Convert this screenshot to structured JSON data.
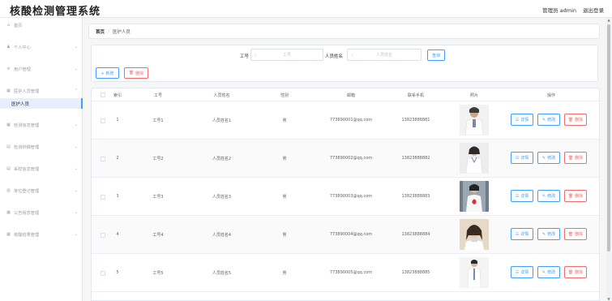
{
  "app": {
    "title": "核酸检测管理系统",
    "user_label": "管理员 admin",
    "logout_label": "退出登录"
  },
  "sidebar": {
    "items": [
      {
        "label": "首页",
        "icon": "home-icon",
        "glyph": "⌂",
        "has_chevron": false
      },
      {
        "label": "个人中心",
        "icon": "user-icon",
        "glyph": "♟",
        "has_chevron": true
      },
      {
        "label": "用户管理",
        "icon": "users-icon",
        "glyph": "≡",
        "has_chevron": true
      },
      {
        "label": "医护人员管理",
        "icon": "grid-icon",
        "glyph": "▦",
        "has_chevron": true
      },
      {
        "label": "检测信息管理",
        "icon": "grid-icon",
        "glyph": "▦",
        "has_chevron": true
      },
      {
        "label": "检测供稿管理",
        "icon": "doc-icon",
        "glyph": "▤",
        "has_chevron": true
      },
      {
        "label": "采样信息管理",
        "icon": "doc-icon",
        "glyph": "▤",
        "has_chevron": true
      },
      {
        "label": "单位登记管理",
        "icon": "chart-icon",
        "glyph": "▥",
        "has_chevron": true
      },
      {
        "label": "公告信息管理",
        "icon": "grid-icon",
        "glyph": "▦",
        "has_chevron": true
      },
      {
        "label": "核酸结果管理",
        "icon": "grid-icon",
        "glyph": "▦",
        "has_chevron": true
      }
    ],
    "active_sub": "医护人员"
  },
  "breadcrumb": {
    "home": "首页",
    "separator": "/",
    "current": "医护人员"
  },
  "search": {
    "id_label": "工号",
    "id_placeholder": "工号",
    "name_label": "人员姓名",
    "name_placeholder": "人员姓名",
    "query_label": "查询",
    "add_label": "+ 新增",
    "delete_label": "删除"
  },
  "table": {
    "headers": [
      "索引",
      "工号",
      "人员姓名",
      "性别",
      "邮箱",
      "联系手机",
      "照片",
      "操作"
    ],
    "rows": [
      {
        "index": "1",
        "id": "工号1",
        "name": "人员姓名1",
        "gender": "男",
        "email": "773890001@qq.com",
        "phone": "13823888881"
      },
      {
        "index": "2",
        "id": "工号2",
        "name": "人员姓名2",
        "gender": "男",
        "email": "773890002@qq.com",
        "phone": "13823888882"
      },
      {
        "index": "3",
        "id": "工号3",
        "name": "人员姓名3",
        "gender": "男",
        "email": "773890003@qq.com",
        "phone": "13823888883"
      },
      {
        "index": "4",
        "id": "工号4",
        "name": "人员姓名4",
        "gender": "男",
        "email": "773890004@qq.com",
        "phone": "13823888884"
      },
      {
        "index": "5",
        "id": "工号5",
        "name": "人员姓名5",
        "gender": "男",
        "email": "773890005@qq.com",
        "phone": "13823888885"
      }
    ],
    "actions": {
      "detail": "详情",
      "edit": "修改",
      "delete": "删除"
    }
  },
  "colors": {
    "primary": "#409eff",
    "danger": "#f56c6c",
    "active_bg": "#e8eefc"
  }
}
